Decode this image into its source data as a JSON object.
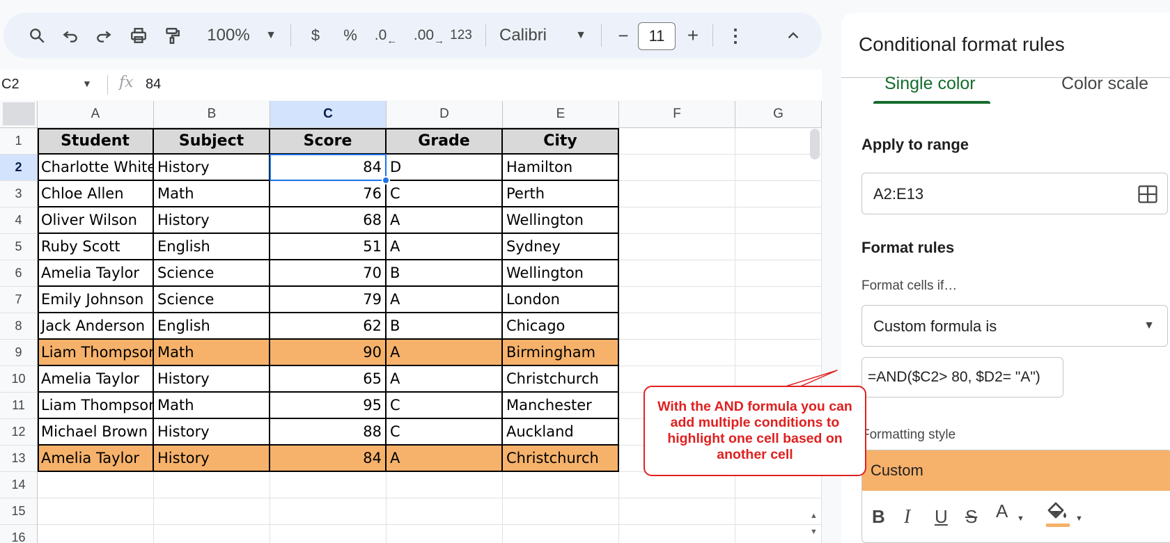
{
  "toolbar": {
    "zoom": "100%",
    "currency": "$",
    "percent": "%",
    "decrease_decimal": ".0",
    "increase_decimal": ".00",
    "number_format": "123",
    "font": "Calibri",
    "font_size": "11",
    "minus": "−",
    "plus": "+"
  },
  "formula_bar": {
    "cell_ref": "C2",
    "fx": "fx",
    "value": "84"
  },
  "sheet": {
    "columns": [
      "A",
      "B",
      "C",
      "D",
      "E",
      "F",
      "G"
    ],
    "row_numbers": [
      "1",
      "2",
      "3",
      "4",
      "5",
      "6",
      "7",
      "8",
      "9",
      "10",
      "11",
      "12",
      "13",
      "14",
      "15",
      "16"
    ],
    "headers": [
      "Student",
      "Subject",
      "Score",
      "Grade",
      "City"
    ],
    "rows": [
      {
        "student": "Charlotte White",
        "subject": "History",
        "score": "84",
        "grade": "D",
        "city": "Hamilton",
        "highlight": false
      },
      {
        "student": "Chloe Allen",
        "subject": "Math",
        "score": "76",
        "grade": "C",
        "city": "Perth",
        "highlight": false
      },
      {
        "student": "Oliver Wilson",
        "subject": "History",
        "score": "68",
        "grade": "A",
        "city": "Wellington",
        "highlight": false
      },
      {
        "student": "Ruby Scott",
        "subject": "English",
        "score": "51",
        "grade": "A",
        "city": "Sydney",
        "highlight": false
      },
      {
        "student": "Amelia Taylor",
        "subject": "Science",
        "score": "70",
        "grade": "B",
        "city": "Wellington",
        "highlight": false
      },
      {
        "student": "Emily Johnson",
        "subject": "Science",
        "score": "79",
        "grade": "A",
        "city": "London",
        "highlight": false
      },
      {
        "student": "Jack Anderson",
        "subject": "English",
        "score": "62",
        "grade": "B",
        "city": "Chicago",
        "highlight": false
      },
      {
        "student": "Liam Thompson",
        "subject": "Math",
        "score": "90",
        "grade": "A",
        "city": "Birmingham",
        "highlight": true
      },
      {
        "student": "Amelia Taylor",
        "subject": "History",
        "score": "65",
        "grade": "A",
        "city": "Christchurch",
        "highlight": false
      },
      {
        "student": "Liam Thompson",
        "subject": "Math",
        "score": "95",
        "grade": "C",
        "city": "Manchester",
        "highlight": false
      },
      {
        "student": "Michael Brown",
        "subject": "History",
        "score": "88",
        "grade": "C",
        "city": "Auckland",
        "highlight": false
      },
      {
        "student": "Amelia Taylor",
        "subject": "History",
        "score": "84",
        "grade": "A",
        "city": "Christchurch",
        "highlight": true
      }
    ],
    "selected_cell": "C2",
    "header_fill": "#d9d9d9",
    "highlight_fill": "#f6b26b"
  },
  "callout": {
    "text": "With the AND formula you can add multiple conditions to highlight one cell based on another cell",
    "color": "#e02020"
  },
  "panel": {
    "title": "Conditional format rules",
    "tabs": [
      "Single color",
      "Color scale"
    ],
    "active_tab": "Single color",
    "apply_to_range_label": "Apply to range",
    "range_value": "A2:E13",
    "format_rules_label": "Format rules",
    "format_cells_if_label": "Format cells if…",
    "condition": "Custom formula is",
    "formula": "=AND($C2> 80, $D2= \"A\")",
    "formatting_style_label": "Formatting style",
    "style_preview": "Custom",
    "style_tools": {
      "bold": "B",
      "italic": "I",
      "underline": "U",
      "strike": "S",
      "text_color": "A"
    },
    "accent_color": "#146c2e"
  }
}
